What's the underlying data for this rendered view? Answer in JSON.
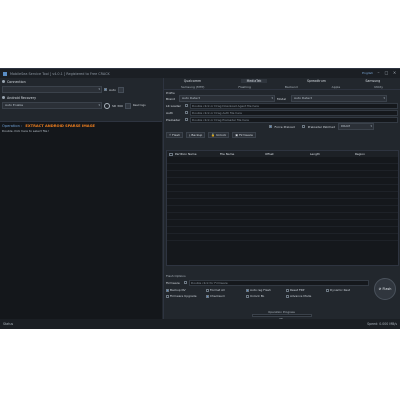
{
  "window": {
    "title": "MobileSea Service Tool [ v4.0.1 ] Registered to Free CRACK",
    "lang": "English",
    "min_icon": "minimize-icon",
    "max_icon": "maximize-icon",
    "close_icon": "close-icon"
  },
  "left": {
    "connection_label": "Connection",
    "connection_value": "",
    "auto_label": "Auto",
    "auto_checked": true,
    "android_section": "Android Recovery",
    "android_value": "Auto Enable",
    "adb_label": "SD 300",
    "sendlog_label": "Read logs",
    "log": {
      "operation_prefix": "Operation :",
      "operation_name": "EXTRACT ANDROID SPARSE IMAGE",
      "line2": "Double click here to select file !"
    }
  },
  "right": {
    "tabs1": [
      "Qualcomm",
      "MediaTek",
      "Spreadtrum",
      "Samsung"
    ],
    "tabs1_active": 1,
    "tabs2": [
      "Samsung (MTP)",
      "Flashing",
      "Backend",
      "Apple",
      "Utility"
    ],
    "profile": {
      "label": "Profile",
      "brand_label": "Brand",
      "brand_value": "Auto Detect",
      "model_label": "Model",
      "model_value": "Auto Detect"
    },
    "fields": [
      {
        "label": "LK Loader",
        "value": "Double click or Drag Download Agent file here"
      },
      {
        "label": "Auth",
        "value": "Double click or Drag Auth file here"
      },
      {
        "label": "Preloader",
        "value": "Double click or Drag Preloader file here"
      }
    ],
    "force_preload": "Force Preload",
    "preloader_patched": "Preloader Patched",
    "preloader_mode": "DRAM",
    "actions": [
      "Flash",
      "Backup",
      "Unlock",
      "Firmware"
    ],
    "grid_headers": [
      "Partition Name",
      "File Name",
      "Offset",
      "Length",
      "Region"
    ],
    "grid_rows": 12,
    "flash_title": "Flash Options",
    "firmware_label": "Firmware",
    "firmware_value": "Double click for Firmware",
    "options": [
      {
        "label": "Backup NV",
        "on": true
      },
      {
        "label": "Format All",
        "on": false
      },
      {
        "label": "Auto reg Flash",
        "on": true
      },
      {
        "label": "Reset FRP",
        "on": false
      },
      {
        "label": "Reset FRP",
        "on": false
      },
      {
        "label": "Dynamic Rest",
        "on": false
      },
      {
        "label": "Firmware Upgrade",
        "on": false
      },
      {
        "label": "Checksum",
        "on": true
      },
      {
        "label": "Unlock BL",
        "on": false
      },
      {
        "label": "Advance Mode",
        "on": false
      }
    ],
    "flash_button": "Flash",
    "op_progress": "Operation Progress",
    "progress_pct": "0%",
    "progress_value": 0
  },
  "status": {
    "left": "Status",
    "right": "Speed: 0.000 MB/s"
  }
}
